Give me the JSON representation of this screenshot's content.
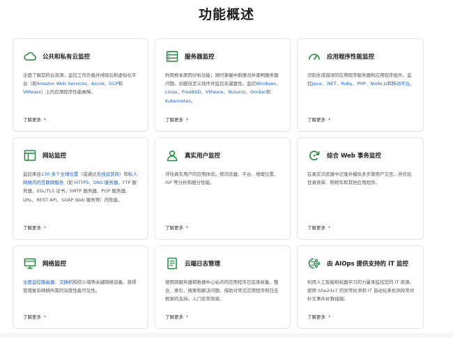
{
  "page": {
    "title": "功能概述"
  },
  "more_label": "了解更多",
  "accent": "#1b8a3a",
  "link_color": "#1a5fd1",
  "cards": [
    {
      "icon": "cloud-icon",
      "title": "公共和私有云监控",
      "desc": [
        {
          "t": "全面了解您的云资源。监控工作负载并排除云和虚拟化平台（如"
        },
        {
          "t": "Amazon Web Services",
          "link": true
        },
        {
          "t": "、"
        },
        {
          "t": "Azure",
          "link": true
        },
        {
          "t": "、"
        },
        {
          "t": "GCP",
          "link": true
        },
        {
          "t": "和"
        },
        {
          "t": "VMware",
          "link": true
        },
        {
          "t": "）上的应用程序性能故障。"
        }
      ]
    },
    {
      "icon": "server-icon",
      "title": "服务器监控",
      "desc": [
        {
          "t": "利用根本原因分析功能，随时掌握中断情况并查明服务器问题。创建自定义插件并监控关键属性。监控"
        },
        {
          "t": "Windows",
          "link": true
        },
        {
          "t": "、"
        },
        {
          "t": "Linux",
          "link": true
        },
        {
          "t": "、"
        },
        {
          "t": "FreeBSD",
          "link": true
        },
        {
          "t": "、"
        },
        {
          "t": "VMware",
          "link": true
        },
        {
          "t": "、"
        },
        {
          "t": "Nutanix",
          "link": true
        },
        {
          "t": "、"
        },
        {
          "t": "Docker",
          "link": true
        },
        {
          "t": "和"
        },
        {
          "t": "Kubernetes",
          "link": true
        },
        {
          "t": "。"
        }
      ]
    },
    {
      "icon": "gauge-icon",
      "title": "应用程序性能监控",
      "desc": [
        {
          "t": "识别生成错误的应用程序服务器和应用程序组件。监控"
        },
        {
          "t": "Java",
          "link": true
        },
        {
          "t": "、"
        },
        {
          "t": ".NET",
          "link": true
        },
        {
          "t": "、"
        },
        {
          "t": "Ruby",
          "link": true
        },
        {
          "t": "、"
        },
        {
          "t": "PHP",
          "link": true
        },
        {
          "t": "、"
        },
        {
          "t": "Node.js",
          "link": true
        },
        {
          "t": "和"
        },
        {
          "t": "移动平台",
          "link": true
        },
        {
          "t": "。"
        }
      ]
    },
    {
      "icon": "browser-window-icon",
      "title": "网站监控",
      "desc": [
        {
          "t": "监控来自"
        },
        {
          "t": "130 多个全球位置",
          "link": true
        },
        {
          "t": "（或通过"
        },
        {
          "t": "无线运营商",
          "link": true
        },
        {
          "t": "）和"
        },
        {
          "t": "私人网络内的互联网服务",
          "link": true
        },
        {
          "t": "（如 "
        },
        {
          "t": "HTTPS",
          "link": true
        },
        {
          "t": "、"
        },
        {
          "t": "DNS 服务器",
          "link": true
        },
        {
          "t": "、FTP 服务器、SSL/TLS 证书、SMTP 服务器、POP 服务器、URL、REST API、SOAP Web 服务等）的性能。"
        }
      ]
    },
    {
      "icon": "user-icon",
      "title": "真实用户监控",
      "desc": [
        {
          "t": "评估真实用户的应用体验。按浏览器、平台、地理位置、ISP 等分析和细分性能。"
        }
      ]
    },
    {
      "icon": "refresh-cycle-icon",
      "title": "综合 Web 事务监控",
      "desc": [
        {
          "t": "在真实浏览器中记录并模拟多步骤用户交互，并优化登录表单、购物车和其他应用程序。"
        }
      ]
    },
    {
      "icon": "monitor-icon",
      "title": "网络监控",
      "desc": [
        {
          "t": "全面监控路由器",
          "link": true
        },
        {
          "t": "、"
        },
        {
          "t": "交换机",
          "link": true
        },
        {
          "t": "和防火墙等关键网络设备。获得管理复杂网络所需的深度性能可见性。"
        }
      ]
    },
    {
      "icon": "log-document-icon",
      "title": "云端日志管理",
      "desc": [
        {
          "t": "使用跨服务器和数据中心站点的应用程序日志来收集、整合、索引、搜索和解决问题。借助对常见应用程序和日志框架的支持，入门非常简单。"
        }
      ]
    },
    {
      "icon": "ai-brain-icon",
      "title": "由 AIOps 提供支持的 IT 监控",
      "desc": [
        {
          "t": "利用人工智能和机器学习的力量来监控您的 IT 资源。使用 Site24x7 的异常检测和 IT 自动化来检测异常并扑灭事件补救措施。"
        }
      ]
    }
  ]
}
